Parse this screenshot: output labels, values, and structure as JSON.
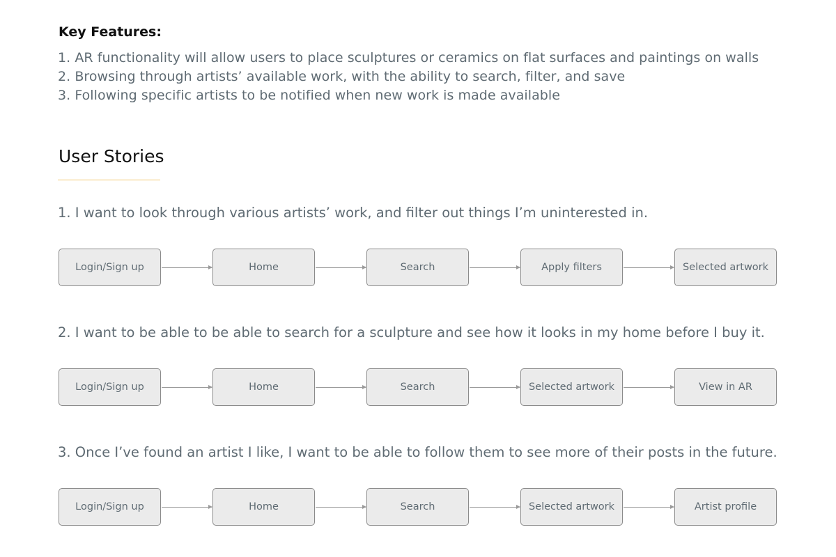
{
  "key_features": {
    "title": "Key Features:",
    "items": [
      "1. AR functionality will allow users to place sculptures or ceramics on flat surfaces and paintings on walls",
      "2. Browsing through artists’ available work, with the ability to search, filter, and save",
      "3. Following specific artists to be notified when new work is made available"
    ]
  },
  "user_stories": {
    "title": "User Stories",
    "stories": [
      {
        "text": "1. I want to look through various artists’ work, and filter out things I’m uninterested in.",
        "steps": [
          "Login/Sign up",
          "Home",
          "Search",
          "Apply filters",
          "Selected artwork"
        ]
      },
      {
        "text": "2. I want to be able to be able to search for a sculpture and see how it looks in my home before I buy it.",
        "steps": [
          "Login/Sign up",
          "Home",
          "Search",
          "Selected artwork",
          "View in AR"
        ]
      },
      {
        "text": "3. Once I’ve found an artist I like, I want to be able to follow them to see more of their posts in the future.",
        "steps": [
          "Login/Sign up",
          "Home",
          "Search",
          "Selected artwork",
          "Artist profile"
        ]
      }
    ]
  },
  "colors": {
    "heading": "#111111",
    "body_text": "#5f6b73",
    "box_fill": "#ebebeb",
    "box_border": "#8b8b8b",
    "accent_underline": "#f2c66d"
  }
}
